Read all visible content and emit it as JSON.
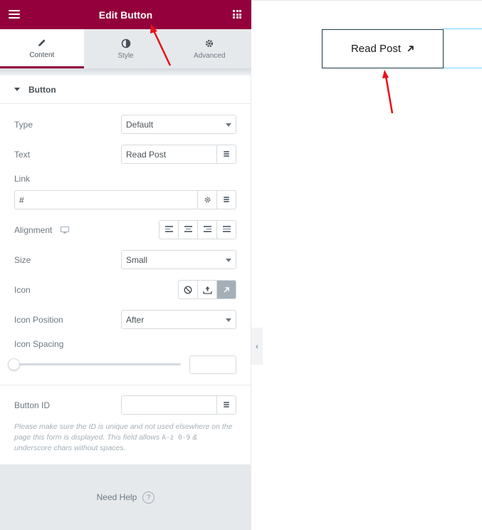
{
  "header": {
    "title": "Edit Button"
  },
  "tabs": [
    {
      "label": "Content",
      "icon": "pencil-icon",
      "active": true
    },
    {
      "label": "Style",
      "icon": "half-circle-icon",
      "active": false
    },
    {
      "label": "Advanced",
      "icon": "gear-icon",
      "active": false
    }
  ],
  "section": {
    "title": "Button"
  },
  "fields": {
    "type": {
      "label": "Type",
      "value": "Default"
    },
    "text": {
      "label": "Text",
      "value": "Read Post"
    },
    "link": {
      "label": "Link",
      "value": "#"
    },
    "alignment": {
      "label": "Alignment"
    },
    "size": {
      "label": "Size",
      "value": "Small"
    },
    "icon": {
      "label": "Icon"
    },
    "icon_position": {
      "label": "Icon Position",
      "value": "After"
    },
    "icon_spacing": {
      "label": "Icon Spacing",
      "slider_value": 0
    },
    "button_id": {
      "label": "Button ID",
      "value": ""
    }
  },
  "note": {
    "part1": "Please make sure the ID is unique and not used elsewhere on the page this form is displayed. This field allows ",
    "code": "A-z 0-9",
    "part2": " & underscore chars without spaces."
  },
  "help": {
    "label": "Need Help",
    "q": "?"
  },
  "collapse": {
    "glyph": "‹"
  },
  "preview": {
    "button_label": "Read Post"
  },
  "colors": {
    "brand": "#93003c",
    "annotation_arrow": "#e8101a",
    "preview_border": "#1b3b45",
    "guide": "#71d7f7"
  }
}
